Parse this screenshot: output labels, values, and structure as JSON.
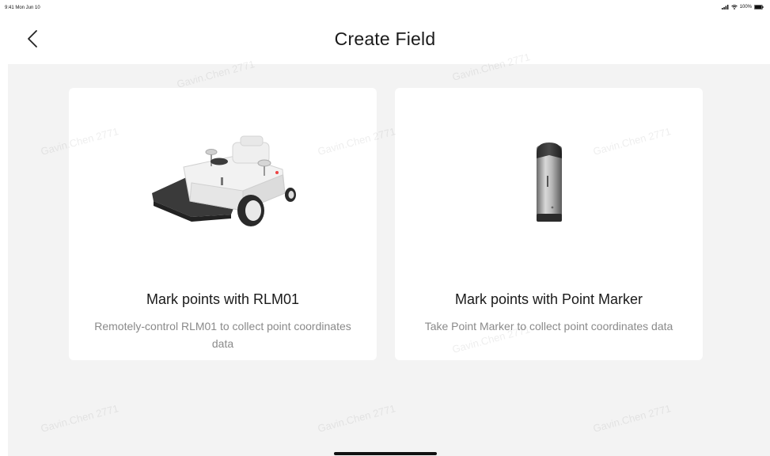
{
  "status_bar": {
    "time": "9:41 Mon Jun 10",
    "battery": "100%",
    "icons": [
      "signal-icon",
      "wifi-icon",
      "battery-icon"
    ]
  },
  "header": {
    "title": "Create Field",
    "back_icon": "chevron-left-icon"
  },
  "cards": [
    {
      "title": "Mark points with RLM01",
      "description": "Remotely-control RLM01 to collect point coordinates data"
    },
    {
      "title": "Mark points with Point Marker",
      "description": "Take Point Marker to collect point coordinates data"
    }
  ],
  "watermark": "Gavin.Chen 2771",
  "colors": {
    "background": "#f3f3f3",
    "card": "#ffffff",
    "title": "#1a1a1a",
    "description": "#8a8a8a"
  }
}
